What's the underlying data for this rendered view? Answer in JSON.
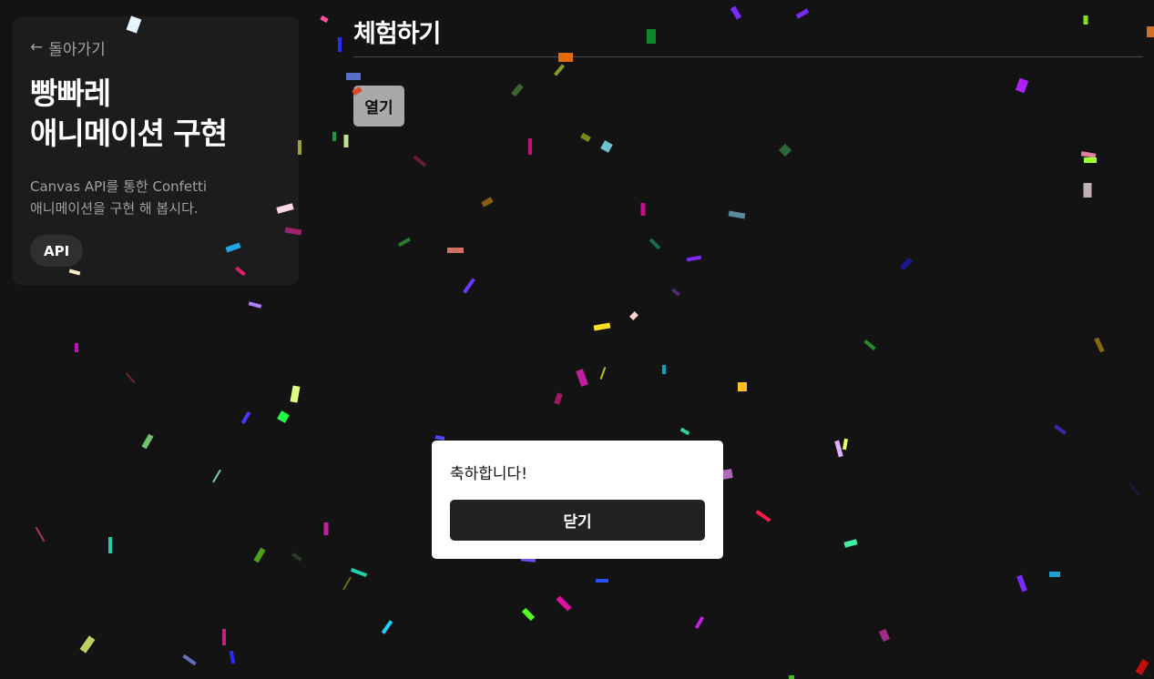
{
  "sidebar": {
    "back_arrow": "←",
    "back_label": "돌아가기",
    "title_line1": "빵빠레",
    "title_line2": "애니메이션 구현",
    "description_line1": "Canvas API를 통한 Confetti",
    "description_line2": "애니메이션을 구현 해 봅시다.",
    "tag": "API"
  },
  "main": {
    "title": "체험하기",
    "open_button_label": "열기"
  },
  "modal": {
    "message": "축하합니다!",
    "close_button_label": "닫기"
  },
  "colors": {
    "background": "#131313",
    "card": "#1c1c1c",
    "open_button": "#a9a9a9",
    "modal_background": "#ffffff",
    "close_button": "#222222"
  }
}
